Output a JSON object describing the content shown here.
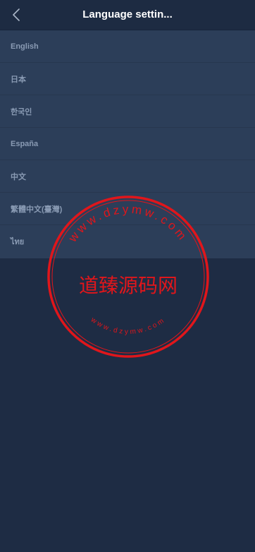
{
  "header": {
    "title": "Language settin...",
    "back_icon": "chevron-left-icon"
  },
  "languages": [
    {
      "label": "English"
    },
    {
      "label": "日本"
    },
    {
      "label": "한국인"
    },
    {
      "label": "España"
    },
    {
      "label": "中文"
    },
    {
      "label": "繁體中文(臺灣)"
    },
    {
      "label": "ไทย"
    }
  ],
  "watermark": {
    "center_text": "道臻源码网",
    "top_arc_text": "www.dzymw.com",
    "bottom_arc_text": "www.dzymw.com",
    "color": "#e0161b"
  },
  "colors": {
    "background": "#1e2c44",
    "list_background": "#2c3e59",
    "item_text": "#8a9bb4",
    "title_text": "#ffffff"
  }
}
